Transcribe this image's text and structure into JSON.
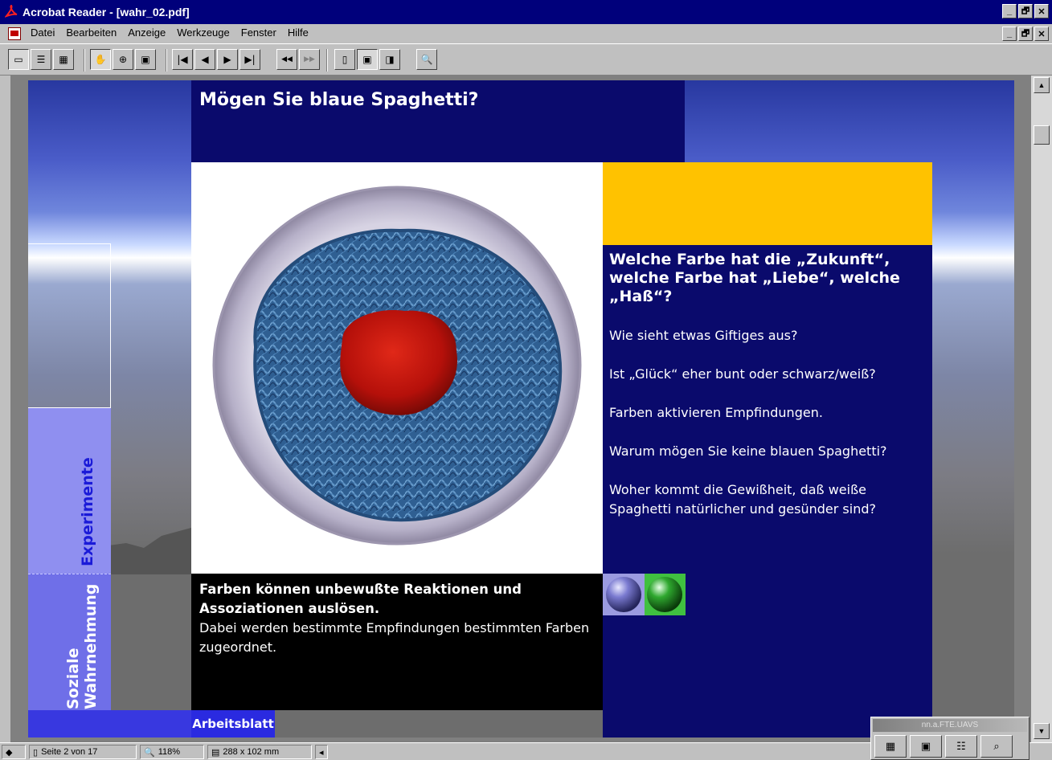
{
  "window": {
    "title": "Acrobat Reader - [wahr_02.pdf]",
    "buttons": {
      "minimize": "_",
      "restore": "🗗",
      "close": "✕"
    }
  },
  "menu": [
    "Datei",
    "Bearbeiten",
    "Anzeige",
    "Werkzeuge",
    "Fenster",
    "Hilfe"
  ],
  "toolbar": {
    "icons": [
      "page-only-icon",
      "bookmarks-icon",
      "thumbnails-icon",
      "hand-tool-icon",
      "zoom-tool-icon",
      "text-select-icon",
      "first-page-icon",
      "previous-page-icon",
      "next-page-icon",
      "last-page-icon",
      "go-back-icon",
      "go-forward-icon",
      "actual-size-icon",
      "fit-page-icon",
      "fit-width-icon",
      "find-icon"
    ],
    "glyphs": {
      "first": "|◀",
      "prev": "◀",
      "next": "▶",
      "last": "▶|",
      "back": "◀◀",
      "forward": "▶▶",
      "find": "🔍"
    }
  },
  "document": {
    "title": "Mögen Sie blaue Spaghetti?",
    "question_head": "Welche Farbe hat die „Zukunft“, welche Farbe hat „Liebe“, welche „Haß“?",
    "questions": [
      "Wie sieht etwas Giftiges aus?",
      "Ist „Glück“ eher bunt oder schwarz/weiß?",
      "Farben aktivieren Empfindungen.",
      "Warum mögen Sie keine blauen Spaghetti?",
      "Woher kommt die Gewißheit, daß weiße Spaghetti natürlicher und gesünder sind?"
    ],
    "caption_bold": "Farben können unbewußte Reaktionen und Assoziationen auslösen.",
    "caption_normal": "Dabei werden bestimmte Empfindungen bestimmten Farben zugeordnet.",
    "worksheet_label": "Arbeitsblatt",
    "tab_experiments": "Experimente",
    "tab_social_line1": "Soziale",
    "tab_social_line2": "Wahrnehmung",
    "colors": {
      "navy": "#0a0a6c",
      "orange": "#ffc200",
      "blue_pasta": "#3a6ea0",
      "sauce": "#c0140c"
    }
  },
  "status": {
    "page": "Seite 2 von 17",
    "zoom": "118%",
    "size": "288 x 102 mm"
  },
  "mini_window": {
    "title": "nn.a.FTE.UAVS"
  }
}
